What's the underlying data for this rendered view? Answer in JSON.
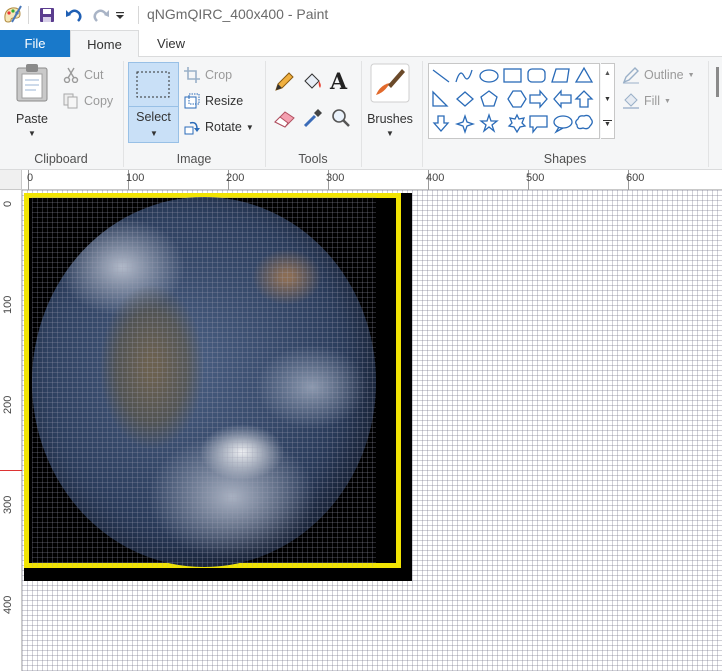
{
  "window": {
    "title": "qNGmQIRC_400x400 - Paint"
  },
  "tabs": [
    {
      "label": "File",
      "active": false
    },
    {
      "label": "Home",
      "active": true
    },
    {
      "label": "View",
      "active": false
    }
  ],
  "ribbon": {
    "clipboard": {
      "group_label": "Clipboard",
      "paste": "Paste",
      "cut": "Cut",
      "copy": "Copy"
    },
    "image": {
      "group_label": "Image",
      "select": "Select",
      "crop": "Crop",
      "resize": "Resize",
      "rotate": "Rotate"
    },
    "tools": {
      "group_label": "Tools",
      "icons": [
        "pencil-icon",
        "fill-bucket-icon",
        "text-icon",
        "eraser-icon",
        "color-picker-icon",
        "magnifier-icon"
      ],
      "text_glyph": "A"
    },
    "brushes": {
      "label": "Brushes"
    },
    "shapes": {
      "group_label": "Shapes",
      "outline": "Outline",
      "fill": "Fill"
    }
  },
  "rulers": {
    "top": [
      "0",
      "100",
      "200",
      "300",
      "400",
      "500",
      "600"
    ],
    "left": [
      "0",
      "100",
      "200",
      "300",
      "400"
    ]
  },
  "colors": {
    "file_tab": "#1979ca",
    "ribbon_bg": "#f5f6f7",
    "image_border": "#f1e404",
    "select_highlight": "#c9e0f7"
  }
}
